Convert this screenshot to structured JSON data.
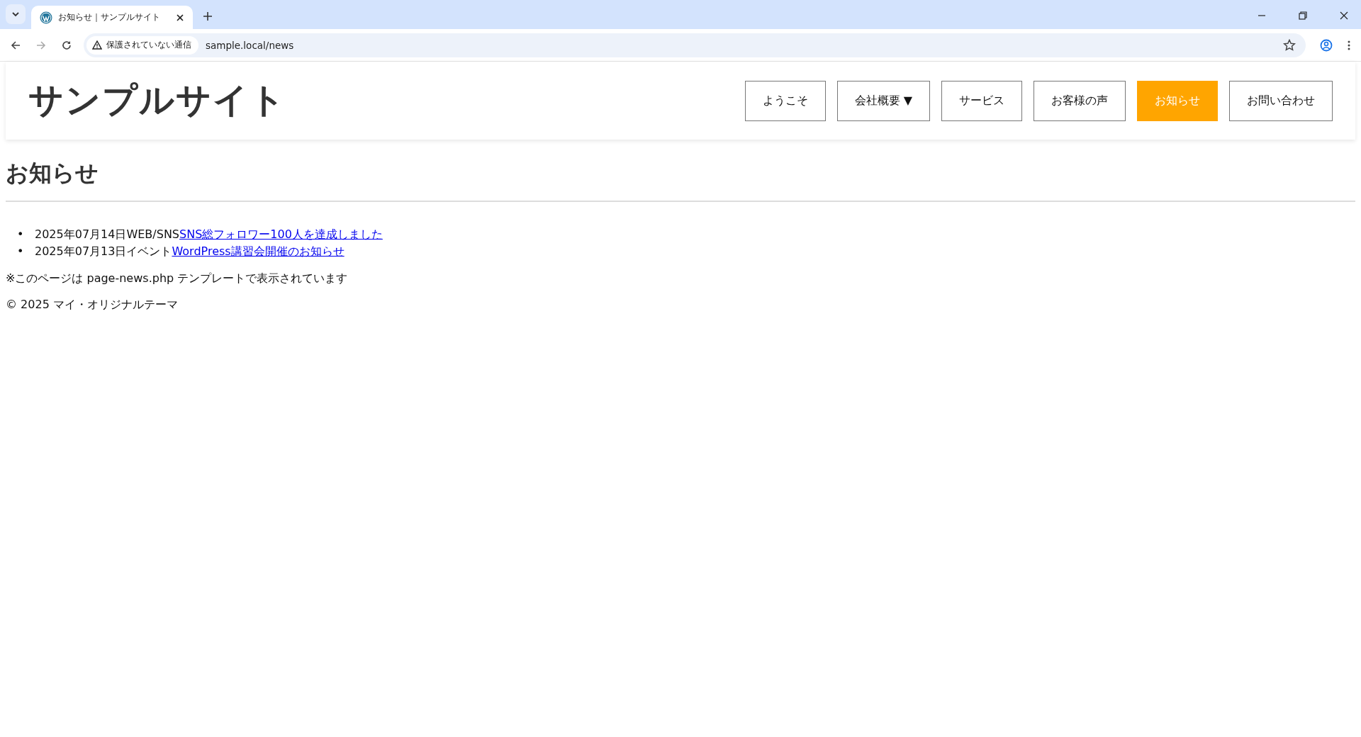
{
  "browser": {
    "tab": {
      "title": "お知らせ｜サンプルサイト",
      "selected": true
    },
    "security_chip": "保護されていない通信",
    "url": "sample.local/news"
  },
  "site": {
    "title": "サンプルサイト",
    "nav": [
      {
        "label": "ようこそ",
        "selected": false
      },
      {
        "label": "会社概要",
        "caret": "▼",
        "selected": false
      },
      {
        "label": "サービス",
        "selected": false
      },
      {
        "label": "お客様の声",
        "selected": false
      },
      {
        "label": "お知らせ",
        "selected": true
      },
      {
        "label": "お問い合わせ",
        "selected": false
      }
    ]
  },
  "page": {
    "heading": "お知らせ",
    "news": [
      {
        "bullet": "•",
        "date": "2025年07月14日",
        "category": "WEB/SNS",
        "title": "SNS総フォロワー100人を達成しました"
      },
      {
        "bullet": "•",
        "date": "2025年07月13日",
        "category": "イベント",
        "title": "WordPress講習会開催のお知らせ"
      }
    ],
    "note": "※このページは page-news.php テンプレートで表示されています"
  },
  "footer": {
    "copyright": "© 2025 マイ・オリジナルテーマ"
  }
}
